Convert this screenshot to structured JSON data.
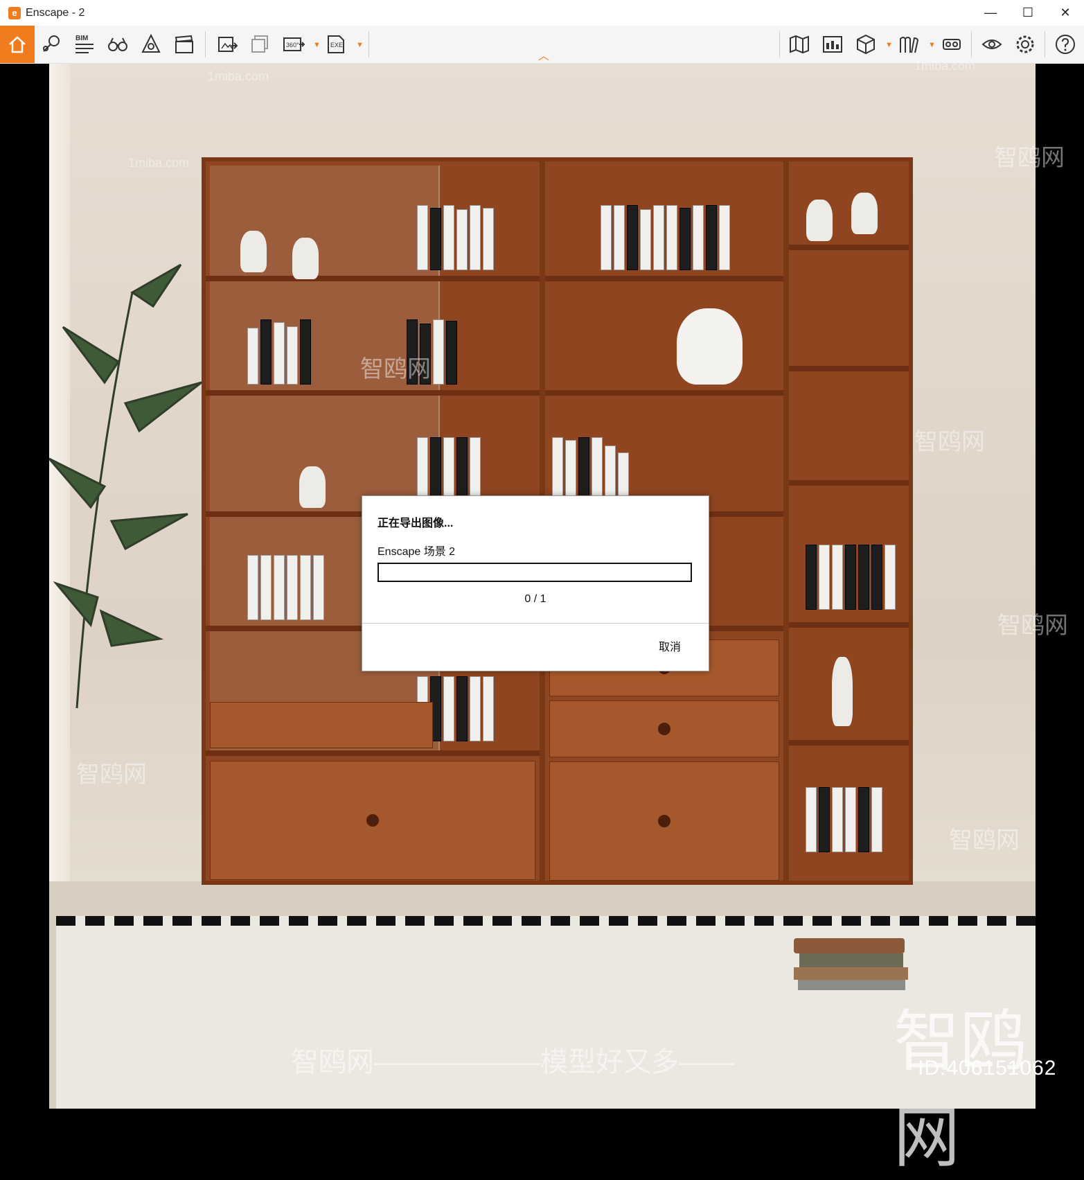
{
  "window": {
    "title": "Enscape - 2",
    "logo_letter": "e",
    "minimize": "—",
    "maximize": "☐",
    "close": "✕"
  },
  "toolbar": {
    "accent": "#f07c1e",
    "left_tools": [
      {
        "name": "home-icon"
      },
      {
        "name": "navigation-pin-icon"
      },
      {
        "name": "bim-icon",
        "label": "BIM"
      },
      {
        "name": "binoculars-icon"
      },
      {
        "name": "asset-library-icon"
      },
      {
        "name": "clapperboard-icon"
      },
      {
        "name": "export-image-icon"
      },
      {
        "name": "batch-export-icon"
      },
      {
        "name": "panorama-360-icon",
        "label": "360°"
      },
      {
        "name": "exe-export-icon",
        "label": "EXE"
      }
    ],
    "right_tools": [
      {
        "name": "map-icon"
      },
      {
        "name": "views-icon"
      },
      {
        "name": "cube-icon"
      },
      {
        "name": "books-icon"
      },
      {
        "name": "vr-headset-icon"
      },
      {
        "name": "eye-icon"
      },
      {
        "name": "settings-gear-icon"
      },
      {
        "name": "help-icon"
      }
    ]
  },
  "dialog": {
    "title": "正在导出图像...",
    "scene_name": "Enscape 场景 2",
    "progress": 0,
    "counter": "0 / 1",
    "cancel_label": "取消"
  },
  "watermarks": {
    "site": "1miba.com",
    "brand": "智鸥网",
    "bottom": "智鸥网——————模型好又多——",
    "big": "智鸥网",
    "id": "ID:406151062"
  }
}
